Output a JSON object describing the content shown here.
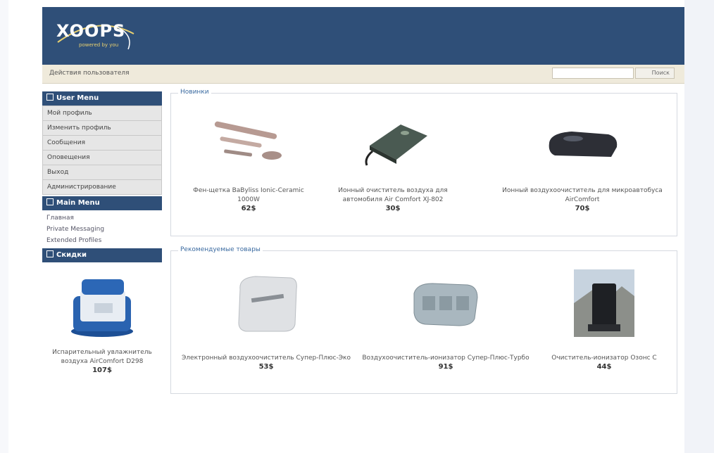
{
  "header": {
    "logo_text": "XOOPS",
    "logo_sub": "powered by you"
  },
  "topbar": {
    "text": "Действия пользователя",
    "search_placeholder": "",
    "search_button": "Поиск"
  },
  "sidebar": {
    "user_menu": {
      "title": "User Menu",
      "items": [
        "Мой профиль",
        "Изменить профиль",
        "Сообщения",
        "Оповещения",
        "Выход",
        "Администрирование"
      ]
    },
    "main_menu": {
      "title": "Main Menu",
      "items": [
        "Главная",
        "Private Messaging",
        "Extended Profiles"
      ]
    },
    "featured": {
      "title": "Скидки",
      "name": "Испарительный увлажнитель воздуха AirComfort D298",
      "price": "107$"
    }
  },
  "new_products": {
    "title": "Новинки",
    "items": [
      {
        "name": "Фен-щетка BaByliss Ionic-Ceramic 1000W",
        "price": "62$"
      },
      {
        "name": "Ионный очиститель воздуха для автомобиля Air Comfort XJ-802",
        "price": "30$"
      },
      {
        "name": "Ионный воздухоочиститель для микроавтобуса AirComfort",
        "price": "70$"
      }
    ]
  },
  "recommended": {
    "title": "Рекомендуемые товары",
    "items": [
      {
        "name": "Электронный воздухоочиститель Супер-Плюс-Эко",
        "price": "53$"
      },
      {
        "name": "Воздухоочиститель-ионизатор Супер-Плюс-Турбо",
        "price": "91$"
      },
      {
        "name": "Очиститель-ионизатор Озонс С",
        "price": "44$"
      }
    ]
  },
  "colors": {
    "header": "#2f4f78",
    "topbar": "#efeadb",
    "legend": "#3a6aa0"
  }
}
